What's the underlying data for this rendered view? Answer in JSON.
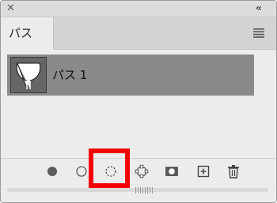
{
  "window": {
    "close_icon": "close-icon",
    "collapse_icon": "double-chevron-left-icon",
    "close_glyph": "✕",
    "collapse_glyph": "‹‹"
  },
  "panel": {
    "tab_label": "パス",
    "menu_icon": "panel-menu-icon"
  },
  "paths": [
    {
      "label": "パス 1",
      "selected": true
    }
  ],
  "footer": {
    "tools": [
      {
        "name": "fill-path-icon"
      },
      {
        "name": "stroke-path-icon"
      },
      {
        "name": "load-path-as-selection-icon",
        "highlighted": true
      },
      {
        "name": "make-work-path-icon"
      },
      {
        "name": "add-mask-icon"
      },
      {
        "name": "create-new-path-icon"
      },
      {
        "name": "delete-path-icon"
      }
    ]
  },
  "colors": {
    "panel_bg": "#ececec",
    "selected_row": "#8a8a8a",
    "highlight": "#f50000"
  }
}
